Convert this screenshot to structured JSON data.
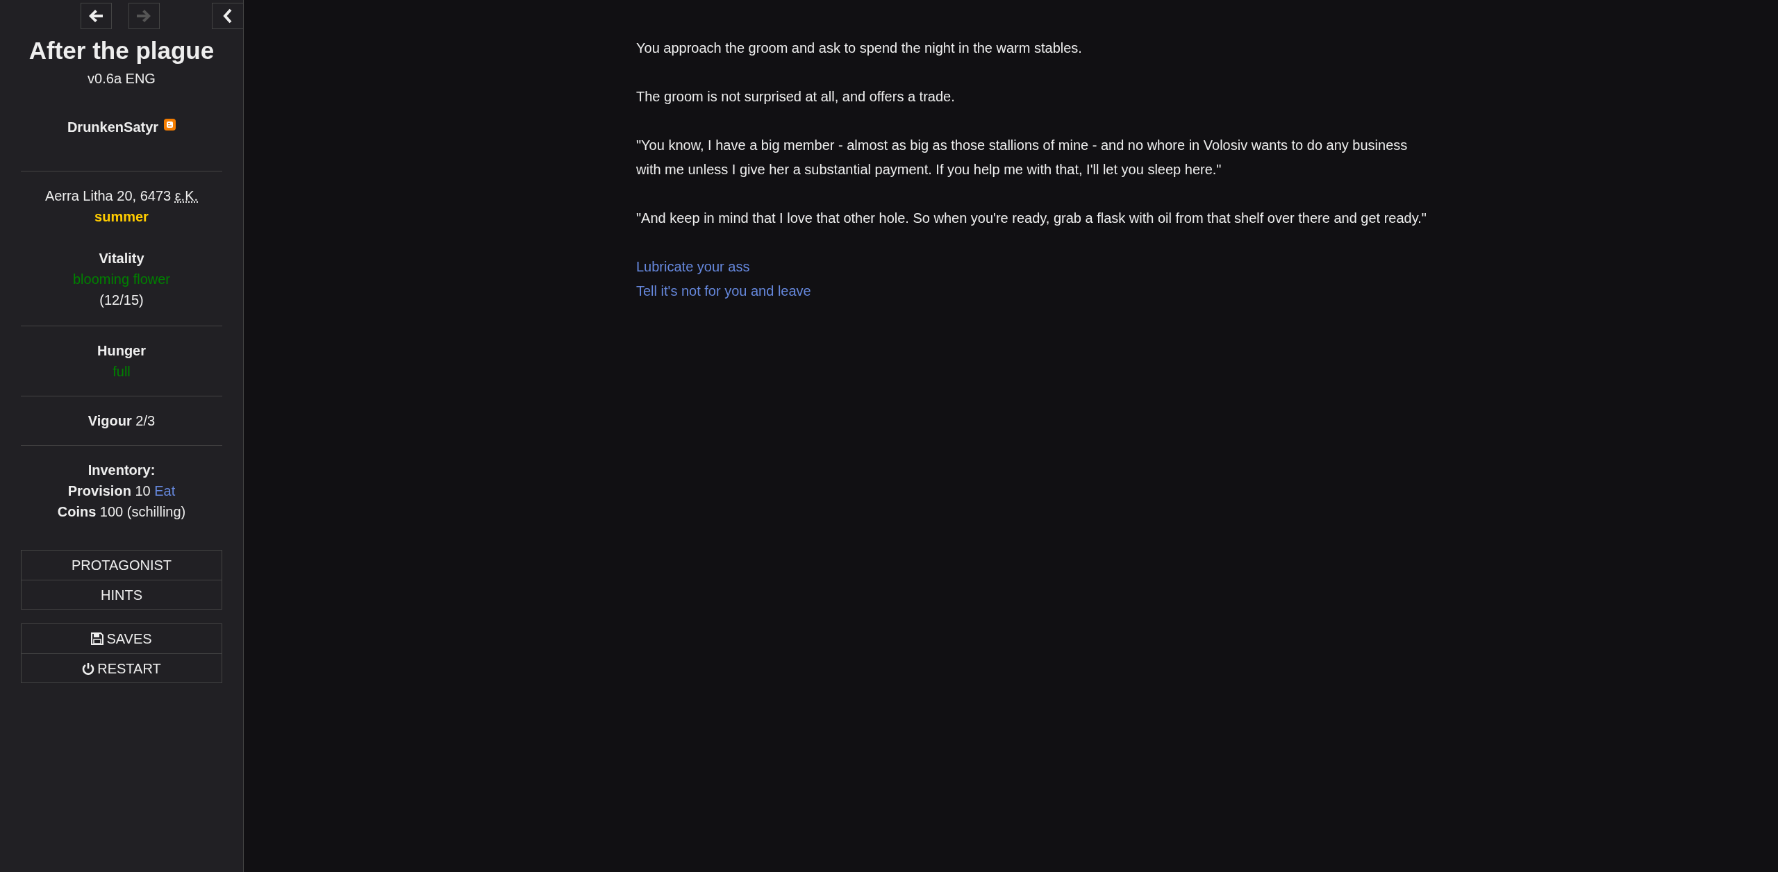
{
  "history": [
    {
      "kind": "back",
      "disabled": false
    },
    {
      "kind": "forward",
      "disabled": true
    }
  ],
  "sidebar_toggle": {
    "kind": "collapse"
  },
  "title": "After the plague",
  "version": "v0.6a ENG",
  "author": {
    "name": "DrunkenSatyr",
    "kind": "blog"
  },
  "date": {
    "text": "Aerra Litha 20, 6473",
    "era": "ε.K."
  },
  "season": {
    "text": "summer",
    "color": "#ffcc00"
  },
  "stats": [
    {
      "kind": "block",
      "label": "Vitality",
      "status": "blooming flower",
      "color": "#008000",
      "reading": "(12/15)"
    },
    {
      "kind": "block",
      "label": "Hunger",
      "status": "full",
      "color": "#008000"
    },
    {
      "kind": "inline",
      "label": "Vigour",
      "reading": "2/3"
    }
  ],
  "inventory": {
    "label": "Inventory:",
    "items": [
      {
        "name": "Provision",
        "amount": "10",
        "action": "Eat"
      },
      {
        "name": "Coins",
        "amount": "100 (schilling)"
      }
    ]
  },
  "menus": [
    [
      {
        "label": "PROTAGONIST"
      },
      {
        "label": "HINTS"
      }
    ],
    [
      {
        "label": "SAVES",
        "kind": "save"
      },
      {
        "label": "RESTART",
        "kind": "power"
      }
    ]
  ],
  "passage": [
    "You approach the groom and ask to spend the night in the warm stables.",
    "The groom is not surprised at all, and offers a trade.",
    "\"You know, I have a big member - almost as big as those stallions of mine - and no whore in Volosiv wants to do any business with me unless I give her a substantial payment. If you help me with that, I'll let you sleep here.\"",
    "\"And keep in mind that I love that other hole. So when you're ready, grab a flask with oil from that shelf over there and get ready.\""
  ],
  "choices": [
    "Lubricate your ass",
    "Tell it's not for you and leave"
  ]
}
